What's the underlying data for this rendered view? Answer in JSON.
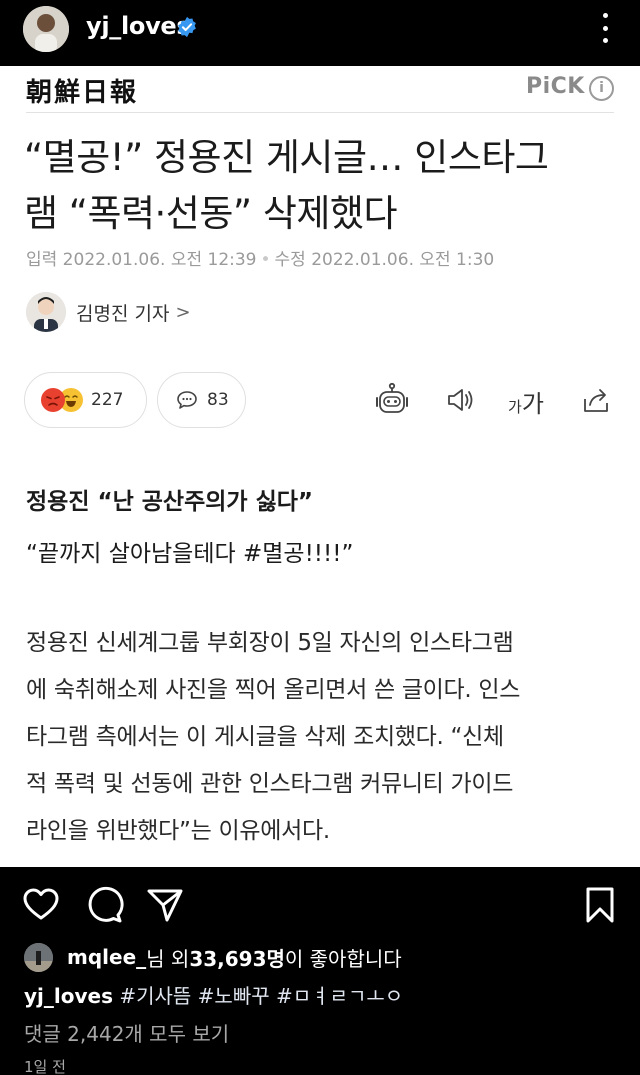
{
  "post": {
    "username": "yj_loves",
    "verified": true
  },
  "article": {
    "publisher_logo_text": "朝鮮日報",
    "pick_label": "PiCK",
    "pick_info": "i",
    "headline_line1": "“멸공!” 정용진 게시글… 인스타그",
    "headline_line2": "램 “폭력·선동” 삭제했다",
    "published": "입력 2022.01.06. 오전 12:39",
    "separator": "•",
    "modified": "수정 2022.01.06. 오전 1:30",
    "reporter": "김명진 기자",
    "reporter_chevron": ">",
    "reaction_count": "227",
    "comment_count": "83",
    "font_size_small": "가",
    "font_size_large": "가",
    "subhead": "정용진 “난 공산주의가 싫다”",
    "subhead2": "“끝까지 살아남을테다 #멸공!!!!”",
    "body_lines": [
      "정용진 신세계그룹 부회장이 5일 자신의 인스타그램",
      "에 숙취해소제 사진을 찍어 올리면서 쓴 글이다. 인스",
      "타그램 측에서는 이 게시글을 삭제 조치했다. “신체",
      "적 폭력 및 선동에 관한 인스타그램 커뮤니티 가이드",
      "라인을 위반했다”는 이유에서다."
    ]
  },
  "likes": {
    "liker": "mqlee_",
    "text_mid": "님 외 ",
    "count": "33,693명",
    "text_end": "이 좋아합니다"
  },
  "caption": {
    "username": "yj_loves",
    "text": " #기사뜸 #노빠꾸 #ㅁㅕㄹㄱㅗㅇ"
  },
  "comments_link": "댓글 2,442개 모두 보기",
  "time_ago": "1일 전",
  "colors": {
    "verified_badge": "#3897f0",
    "reaction_angry": "#e8412f",
    "reaction_laugh": "#f6c233"
  },
  "icons": [
    "more-icon",
    "verified-icon",
    "robot-icon",
    "speaker-icon",
    "share-icon",
    "comment-bubble-icon",
    "heart-icon",
    "direct-icon",
    "bookmark-icon"
  ]
}
